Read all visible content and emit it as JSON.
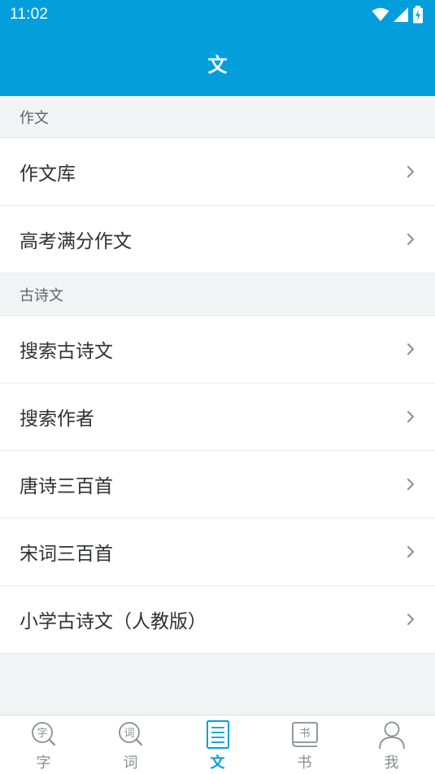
{
  "status_bar": {
    "time": "11:02"
  },
  "app_bar": {
    "title": "文"
  },
  "sections": [
    {
      "header": "作文",
      "items": [
        {
          "label": "作文库"
        },
        {
          "label": "高考满分作文"
        }
      ]
    },
    {
      "header": "古诗文",
      "items": [
        {
          "label": "搜索古诗文"
        },
        {
          "label": "搜索作者"
        },
        {
          "label": "唐诗三百首"
        },
        {
          "label": "宋词三百首"
        },
        {
          "label": "小学古诗文（人教版）"
        }
      ]
    }
  ],
  "tabs": [
    {
      "label": "字",
      "glyph": "字",
      "icon": "zi-icon",
      "active": false
    },
    {
      "label": "词",
      "glyph": "词",
      "icon": "ci-icon",
      "active": false
    },
    {
      "label": "文",
      "icon": "document-icon",
      "active": true
    },
    {
      "label": "书",
      "glyph": "书",
      "icon": "book-icon",
      "active": false
    },
    {
      "label": "我",
      "icon": "person-icon",
      "active": false
    }
  ],
  "colors": {
    "primary": "#039fdc",
    "inactive": "#8a8d94",
    "text": "#303133",
    "section_bg": "#f2f3f5"
  }
}
